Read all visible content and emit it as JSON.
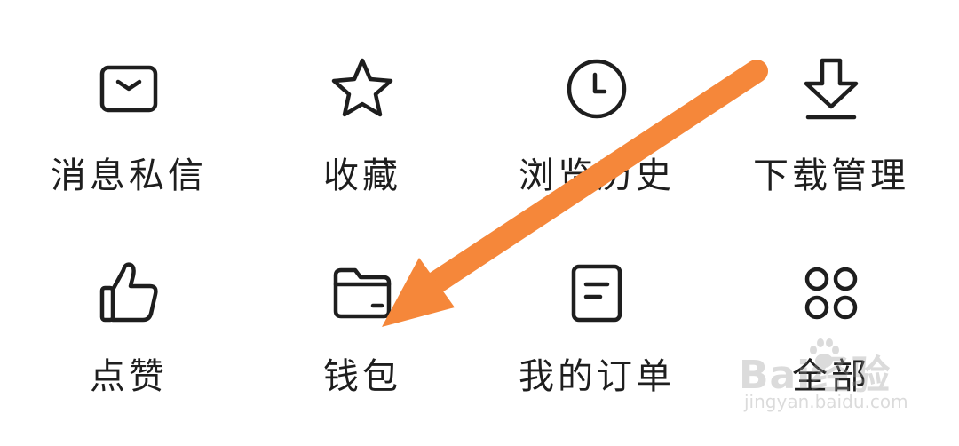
{
  "menu": {
    "items": [
      {
        "label": "消息私信",
        "icon": "mail-icon"
      },
      {
        "label": "收藏",
        "icon": "star-icon"
      },
      {
        "label": "浏览历史",
        "icon": "clock-icon"
      },
      {
        "label": "下载管理",
        "icon": "download-icon"
      },
      {
        "label": "点赞",
        "icon": "thumbs-up-icon"
      },
      {
        "label": "钱包",
        "icon": "wallet-icon"
      },
      {
        "label": "我的订单",
        "icon": "order-icon"
      },
      {
        "label": "全部",
        "icon": "all-apps-icon"
      }
    ]
  },
  "annotation": {
    "arrow_color": "#f5873a"
  },
  "watermark": {
    "logo_text": "Bai经验",
    "url_text": "jingyan.baidu.com"
  },
  "colors": {
    "icon_stroke": "#1e1e1e",
    "text": "#1e1e1e",
    "background": "#ffffff"
  }
}
